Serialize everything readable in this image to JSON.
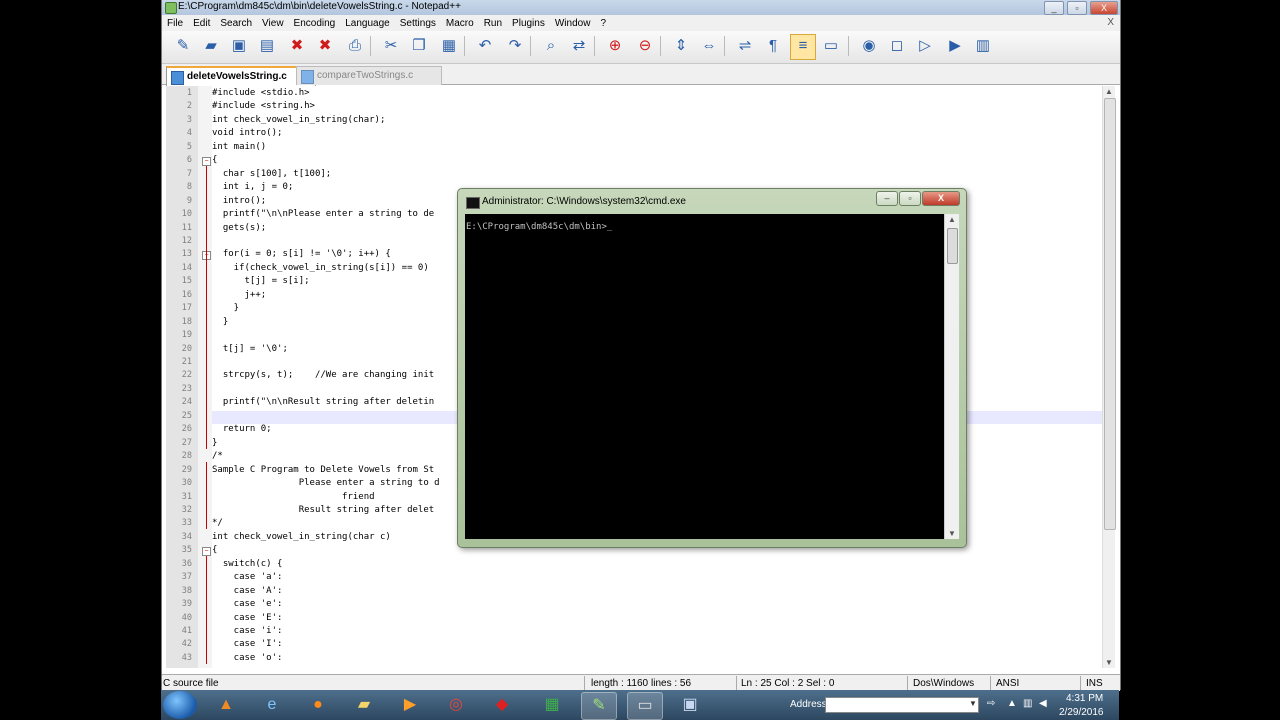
{
  "window": {
    "title": "E:\\CProgram\\dm845c\\dm\\bin\\deleteVowelsString.c - Notepad++",
    "controls": [
      "_",
      "▫",
      "X"
    ]
  },
  "menu": {
    "items": [
      "File",
      "Edit",
      "Search",
      "View",
      "Encoding",
      "Language",
      "Settings",
      "Macro",
      "Run",
      "Plugins",
      "Window",
      "?"
    ],
    "close": "X"
  },
  "toolbar": {
    "icons": [
      "new-file-icon",
      "open-file-icon",
      "save-icon",
      "save-all-icon",
      "close-icon",
      "close-all-icon",
      "print-icon",
      "cut-icon",
      "copy-icon",
      "paste-icon",
      "undo-icon",
      "redo-icon",
      "find-icon",
      "replace-icon",
      "zoom-in-icon",
      "zoom-out-icon",
      "sync-vertical-icon",
      "sync-horizontal-icon",
      "word-wrap-icon",
      "show-all-chars-icon",
      "indent-guide-icon",
      "doc-map-icon",
      "record-macro-icon",
      "stop-macro-icon",
      "play-macro-icon",
      "play-macro-multiple-icon",
      "save-macro-icon"
    ]
  },
  "tabs": [
    {
      "label": "deleteVowelsString.c",
      "active": true
    },
    {
      "label": "compareTwoStrings.c",
      "active": false
    }
  ],
  "editor": {
    "lines": [
      {
        "n": "1",
        "text": "#include <stdio.h>"
      },
      {
        "n": "2",
        "text": "#include <string.h>"
      },
      {
        "n": "3",
        "text": "int check_vowel_in_string(char);"
      },
      {
        "n": "4",
        "text": "void intro();"
      },
      {
        "n": "5",
        "text": "int main()"
      },
      {
        "n": "6",
        "text": "{"
      },
      {
        "n": "7",
        "text": "  char s[100], t[100];"
      },
      {
        "n": "8",
        "text": "  int i, j = 0;"
      },
      {
        "n": "9",
        "text": "  intro();"
      },
      {
        "n": "10",
        "text": "  printf(\"\\n\\nPlease enter a string to de"
      },
      {
        "n": "11",
        "text": "  gets(s);"
      },
      {
        "n": "12",
        "text": ""
      },
      {
        "n": "13",
        "text": "  for(i = 0; s[i] != '\\0'; i++) {"
      },
      {
        "n": "14",
        "text": "    if(check_vowel_in_string(s[i]) == 0)"
      },
      {
        "n": "15",
        "text": "      t[j] = s[i];"
      },
      {
        "n": "16",
        "text": "      j++;"
      },
      {
        "n": "17",
        "text": "    }"
      },
      {
        "n": "18",
        "text": "  }"
      },
      {
        "n": "19",
        "text": ""
      },
      {
        "n": "20",
        "text": "  t[j] = '\\0';"
      },
      {
        "n": "21",
        "text": ""
      },
      {
        "n": "22",
        "text": "  strcpy(s, t);    //We are changing init"
      },
      {
        "n": "23",
        "text": ""
      },
      {
        "n": "24",
        "text": "  printf(\"\\n\\nResult string after deletin"
      },
      {
        "n": "25",
        "text": ""
      },
      {
        "n": "26",
        "text": "  return 0;"
      },
      {
        "n": "27",
        "text": "}"
      },
      {
        "n": "28",
        "text": "/*"
      },
      {
        "n": "29",
        "text": "Sample C Program to Delete Vowels from St"
      },
      {
        "n": "30",
        "text": "                Please enter a string to d"
      },
      {
        "n": "31",
        "text": "                        friend"
      },
      {
        "n": "32",
        "text": "                Result string after delet"
      },
      {
        "n": "33",
        "text": "*/"
      },
      {
        "n": "34",
        "text": "int check_vowel_in_string(char c)"
      },
      {
        "n": "35",
        "text": "{"
      },
      {
        "n": "36",
        "text": "  switch(c) {"
      },
      {
        "n": "37",
        "text": "    case 'a':"
      },
      {
        "n": "38",
        "text": "    case 'A':"
      },
      {
        "n": "39",
        "text": "    case 'e':"
      },
      {
        "n": "40",
        "text": "    case 'E':"
      },
      {
        "n": "41",
        "text": "    case 'i':"
      },
      {
        "n": "42",
        "text": "    case 'I':"
      },
      {
        "n": "43",
        "text": "    case 'o':"
      }
    ]
  },
  "status": {
    "file_type": "C source file",
    "length": "length : 1160",
    "lines": "lines : 56",
    "position": "Ln : 25   Col : 2   Sel : 0",
    "eol": "Dos\\Windows",
    "encoding": "ANSI",
    "mode": "INS"
  },
  "cmd": {
    "title": "Administrator: C:\\Windows\\system32\\cmd.exe",
    "prompt": "E:\\CProgram\\dm845c\\dm\\bin>_",
    "controls": [
      "–",
      "▫",
      "X"
    ]
  },
  "taskbar": {
    "apps": [
      "vlc-icon",
      "ie-icon",
      "firefox-icon",
      "explorer-icon",
      "media-player-icon",
      "chrome-icon",
      "app-red-icon",
      "excel-icon",
      "notepadpp-icon",
      "cmd-icon",
      "save-icon"
    ],
    "address_label": "Address",
    "time": "4:31 PM",
    "date": "2/29/2016"
  }
}
